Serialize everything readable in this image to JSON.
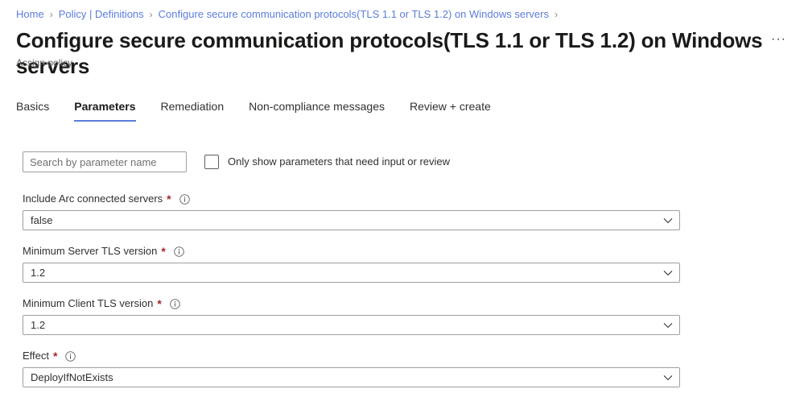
{
  "breadcrumb": {
    "items": [
      {
        "label": "Home"
      },
      {
        "label": "Policy | Definitions"
      },
      {
        "label": "Configure secure communication protocols(TLS 1.1 or TLS 1.2) on Windows servers"
      }
    ],
    "separator": "›"
  },
  "header": {
    "title": "Configure secure communication protocols(TLS 1.1 or TLS 1.2) on Windows servers",
    "subtitle": "Assign policy",
    "more_label": "···"
  },
  "tabs": [
    {
      "label": "Basics",
      "active": false
    },
    {
      "label": "Parameters",
      "active": true
    },
    {
      "label": "Remediation",
      "active": false
    },
    {
      "label": "Non-compliance messages",
      "active": false
    },
    {
      "label": "Review + create",
      "active": false
    }
  ],
  "filter": {
    "search_placeholder": "Search by parameter name",
    "search_value": "",
    "checkbox_label": "Only show parameters that need input or review",
    "checkbox_checked": false
  },
  "parameters": [
    {
      "label": "Include Arc connected servers",
      "required": "*",
      "value": "false"
    },
    {
      "label": "Minimum Server TLS version",
      "required": "*",
      "value": "1.2"
    },
    {
      "label": "Minimum Client TLS version",
      "required": "*",
      "value": "1.2"
    },
    {
      "label": "Effect",
      "required": "*",
      "value": "DeployIfNotExists"
    }
  ],
  "colors": {
    "link": "#5b7ddb",
    "accent": "#5b7ddb",
    "required": "#a4262c",
    "text": "#323130",
    "muted": "#605e5c",
    "border": "#a19f9d"
  }
}
